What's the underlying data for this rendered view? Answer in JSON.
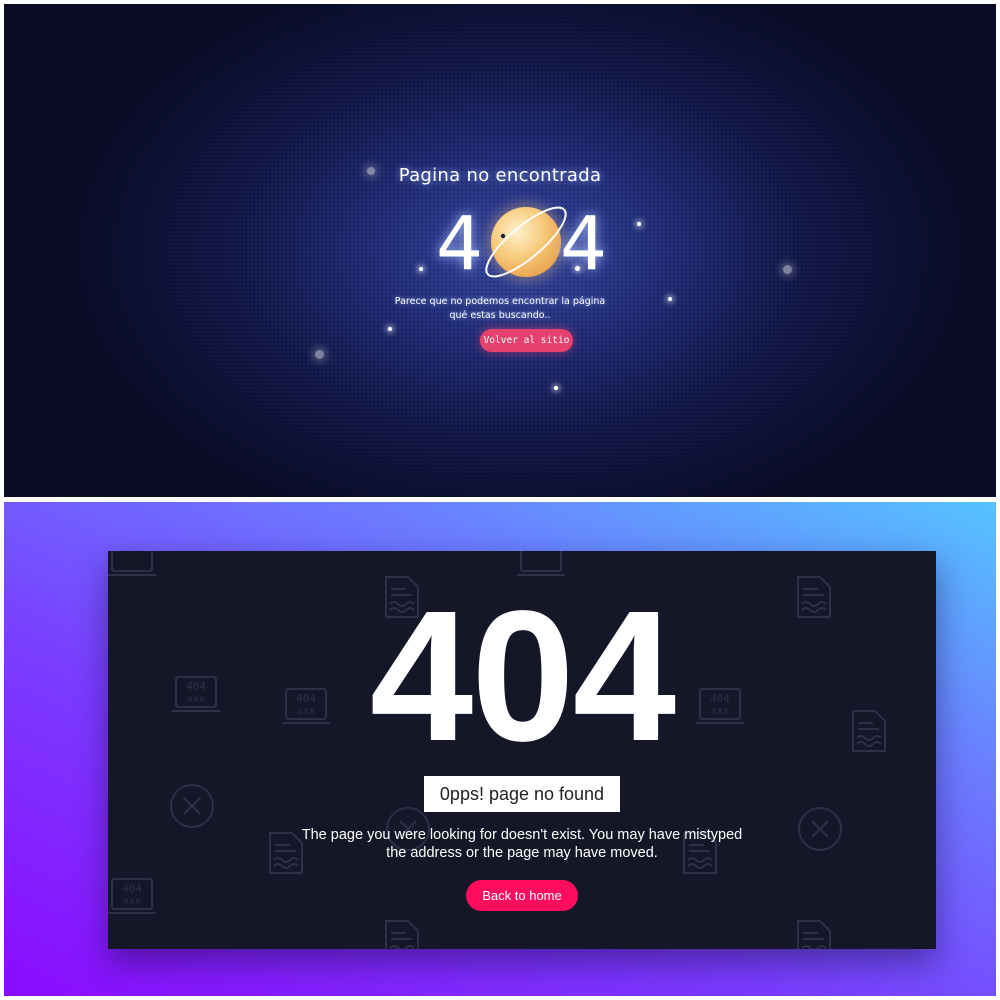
{
  "top_panel": {
    "title": "Pagina no encontrada",
    "digit_left": "4",
    "digit_right": "4",
    "description_line1": "Parece que no podemos encontrar la página",
    "description_line2": "qué estas buscando..",
    "button_label": "Volver al sitio",
    "colors": {
      "background": "#141a4c",
      "button": "#e5416e",
      "planet": "#f6c97a"
    }
  },
  "bottom_panel": {
    "big_text": "404",
    "subtitle": "0pps! page no found",
    "description_line1": "The page you were looking for doesn't exist. You may have mistyped",
    "description_line2": "the address or the page may have moved.",
    "button_label": "Back to home",
    "icon_label_404": "404",
    "icon_label_xxx": "xxx",
    "colors": {
      "gradient_start": "#8b0bff",
      "gradient_end": "#55c3ff",
      "card": "#151729",
      "button": "#ff0d5c"
    }
  }
}
